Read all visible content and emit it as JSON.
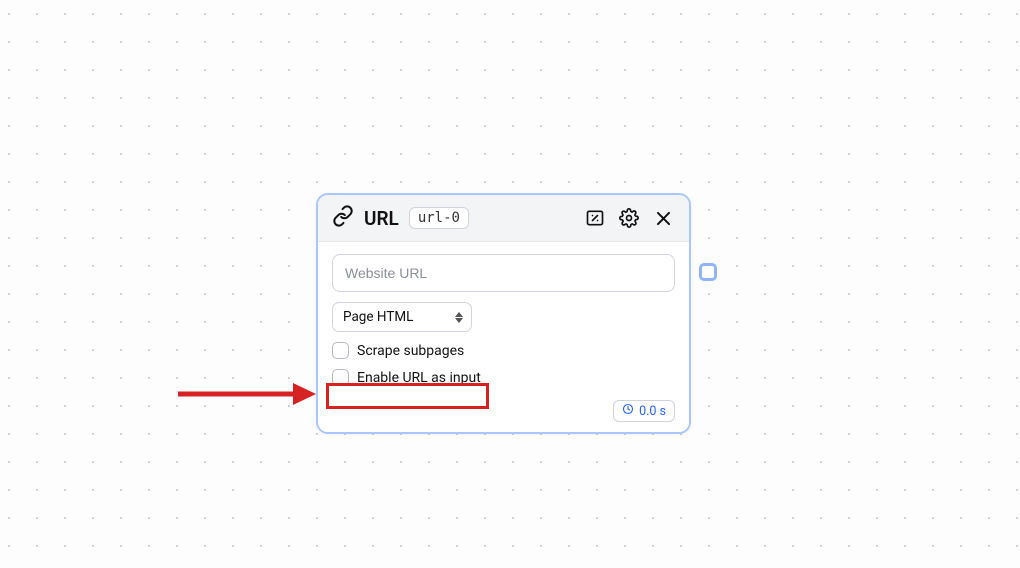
{
  "node": {
    "title": "URL",
    "id_badge": "url-0",
    "url_placeholder": "Website URL",
    "select_value": "Page HTML",
    "checks": {
      "scrape_subpages": "Scrape subpages",
      "enable_url_input": "Enable URL as input"
    },
    "timer": "0.0 s"
  }
}
